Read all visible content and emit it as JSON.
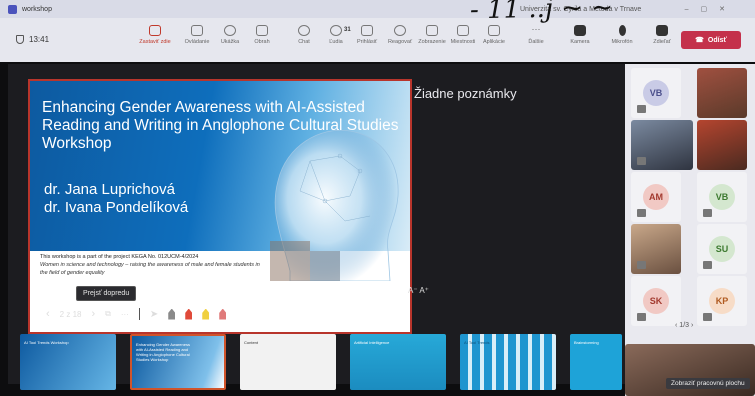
{
  "handwriting": "- 11 ..j ~ ~",
  "window": {
    "title": "workshop",
    "org_text": "Univerzita sv. Cyrila a Metoda v Trnave"
  },
  "toolbar": {
    "timer": "13:41",
    "buttons": [
      {
        "label": "Zastaviť zdie",
        "icon": "stop-share-icon"
      },
      {
        "label": "Ovládanie",
        "icon": "control-icon"
      },
      {
        "label": "Ukážka",
        "icon": "preview-icon"
      },
      {
        "label": "Obrah",
        "icon": "frame-icon"
      },
      {
        "label": "Chat",
        "icon": "chat-icon"
      },
      {
        "label": "Ľudia",
        "icon": "people-icon"
      },
      {
        "label": "Prihlásiť",
        "icon": "raise-hand-icon"
      },
      {
        "label": "Reagovať",
        "icon": "react-icon"
      },
      {
        "label": "Zobrazenie",
        "icon": "view-icon"
      },
      {
        "label": "Miestnosti",
        "icon": "rooms-icon"
      },
      {
        "label": "Aplikácie",
        "icon": "apps-icon"
      },
      {
        "label": "Ďalšie",
        "icon": "more-icon"
      },
      {
        "label": "Kamera",
        "icon": "camera-icon"
      },
      {
        "label": "Mikrofón",
        "icon": "microphone-icon"
      },
      {
        "label": "Zdieľať",
        "icon": "share-icon"
      }
    ],
    "people_count": "31",
    "leave_label": "Odísť"
  },
  "slide": {
    "title": "Enhancing Gender Awareness with AI-Assisted Reading and Writing in Anglophone Cultural Studies Workshop",
    "authors": [
      "dr. Jana Luprichová",
      "dr. Ivana Pondelíková"
    ],
    "note_line": "This workshop is a part of the project KEGA No. 012UCM-4/2024",
    "note_italic": "Women in science and technology – raising the awareness of male and female students in the field of gender equality"
  },
  "notes_text": "Žiadne poznámky",
  "font_controls": "A⁻ A⁺",
  "tooltip": "Prejsť dopredu",
  "controls": {
    "page": "2 z 18",
    "more": "···"
  },
  "thumbnails": [
    {
      "title": "AI Tool Trends Workshop"
    },
    {
      "title": "Enhancing Gender Awareness with AI-Assisted Reading and Writing in Anglophone Cultural Studies Workshop"
    },
    {
      "title": "Content"
    },
    {
      "title": "Artificial Intelligence"
    },
    {
      "title": "AI Tool Trends"
    },
    {
      "title": "Brainstorming"
    }
  ],
  "participants": [
    {
      "initials": "VB",
      "color": "#c9cbe6",
      "text": "#4b4f8c"
    },
    {
      "initials": "AM",
      "color": "#f1c9c4",
      "text": "#a33a2f"
    },
    {
      "initials": "VB",
      "color": "#d4e7cf",
      "text": "#3d7a30"
    },
    {
      "initials": "SU",
      "color": "#d4e7cf",
      "text": "#3d7a30"
    },
    {
      "initials": "SK",
      "color": "#f1c9c4",
      "text": "#a33a2f"
    },
    {
      "initials": "KP",
      "color": "#f7dcc7",
      "text": "#b05a20"
    }
  ],
  "pager": "1/3",
  "work_button": "Zobraziť pracovnú plochu"
}
